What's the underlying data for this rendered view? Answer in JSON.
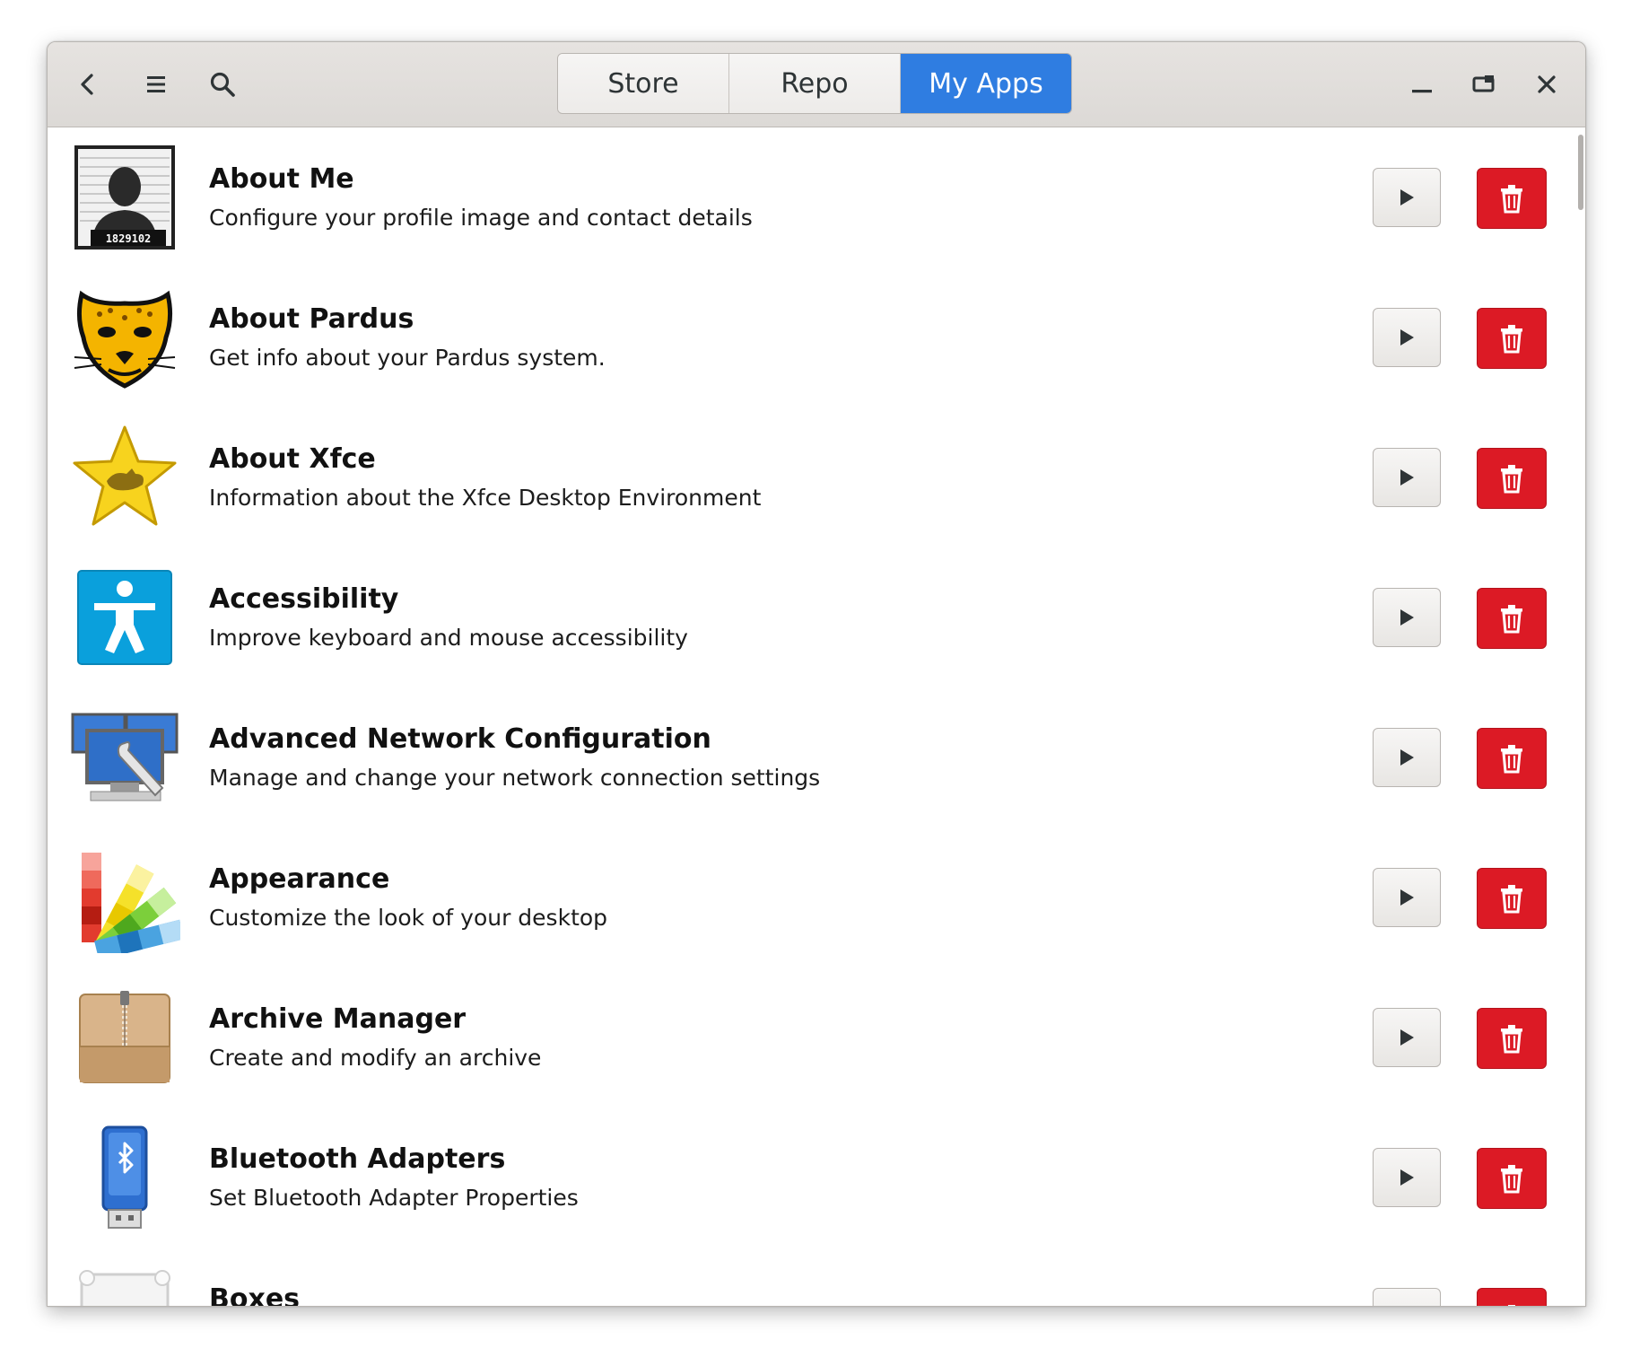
{
  "header": {
    "tabs": [
      {
        "label": "Store",
        "active": false
      },
      {
        "label": "Repo",
        "active": false
      },
      {
        "label": "My Apps",
        "active": true
      }
    ],
    "icons": {
      "back": "chevron-left-icon",
      "menu": "hamburger-menu-icon",
      "search": "search-icon",
      "minimize": "minimize-icon",
      "maximize": "maximize-icon",
      "close": "close-icon"
    },
    "accent_color": "#2f7de1"
  },
  "apps": [
    {
      "name": "About Me",
      "description": "Configure your profile image and contact details",
      "icon": "mugshot-icon",
      "badge": "1829102"
    },
    {
      "name": "About Pardus",
      "description": "Get info about your Pardus system.",
      "icon": "pardus-leopard-icon"
    },
    {
      "name": "About Xfce",
      "description": "Information about the Xfce Desktop Environment",
      "icon": "xfce-star-icon"
    },
    {
      "name": "Accessibility",
      "description": "Improve keyboard and mouse accessibility",
      "icon": "accessibility-icon"
    },
    {
      "name": "Advanced Network Configuration",
      "description": "Manage and change your network connection settings",
      "icon": "network-config-icon"
    },
    {
      "name": "Appearance",
      "description": "Customize the look of your desktop",
      "icon": "color-swatches-icon"
    },
    {
      "name": "Archive Manager",
      "description": "Create and modify an archive",
      "icon": "archive-box-icon"
    },
    {
      "name": "Bluetooth Adapters",
      "description": "Set Bluetooth Adapter Properties",
      "icon": "bluetooth-adapter-icon"
    },
    {
      "name": "Boxes",
      "description": "",
      "icon": "boxes-icon"
    }
  ],
  "row_actions": {
    "run_icon": "play-icon",
    "delete_icon": "trash-icon",
    "delete_color": "#dc1a25"
  }
}
